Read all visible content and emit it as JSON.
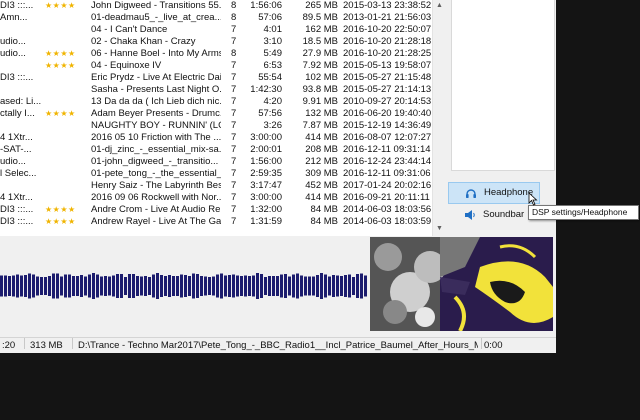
{
  "playlist": {
    "rows": [
      {
        "source": "DI3 :::...",
        "rating": "★★★★",
        "title": "John Digweed - Transitions 55...",
        "track": "8",
        "length": "1:56:06",
        "size": "265 MB",
        "date": "2015-03-13 23:38:52"
      },
      {
        "source": "Amn...",
        "rating": "",
        "title": "01-deadmau5_-_live_at_crea...",
        "track": "8",
        "length": "57:06",
        "size": "89.5 MB",
        "date": "2013-01-21 21:56:03"
      },
      {
        "source": "",
        "rating": "",
        "title": "04 - I Can't Dance",
        "track": "7",
        "length": "4:01",
        "size": "162 MB",
        "date": "2016-10-20 22:50:07"
      },
      {
        "source": "udio...",
        "rating": "",
        "title": "02 - Chaka Khan - Crazy",
        "track": "7",
        "length": "3:10",
        "size": "18.5 MB",
        "date": "2016-10-20 21:28:18"
      },
      {
        "source": "udio...",
        "rating": "★★★★",
        "title": "06 - Hanne Boel - Into My Arms",
        "track": "8",
        "length": "5:49",
        "size": "27.9 MB",
        "date": "2016-10-20 21:28:25"
      },
      {
        "source": "",
        "rating": "★★★★",
        "title": "04 - Equinoxe IV",
        "track": "7",
        "length": "6:53",
        "size": "7.92 MB",
        "date": "2015-05-13 19:58:07"
      },
      {
        "source": "DI3 :::...",
        "rating": "",
        "title": "Eric Prydz - Live At Electric Dai...",
        "track": "7",
        "length": "55:54",
        "size": "102 MB",
        "date": "2015-05-27 21:15:48"
      },
      {
        "source": "",
        "rating": "",
        "title": "Sasha - Presents Last Night O...",
        "track": "7",
        "length": "1:42:30",
        "size": "93.8 MB",
        "date": "2015-05-27 21:14:13"
      },
      {
        "source": "ased: Li...",
        "rating": "",
        "title": "13 Da da da ( Ich Lieb dich nic...",
        "track": "7",
        "length": "4:20",
        "size": "9.91 MB",
        "date": "2010-09-27 20:14:53"
      },
      {
        "source": "ctally I...",
        "rating": "★★★★",
        "title": "Adam Beyer Presents - Drumc...",
        "track": "7",
        "length": "57:56",
        "size": "132 MB",
        "date": "2016-06-20 19:40:40"
      },
      {
        "source": "",
        "rating": "",
        "title": "NAUGHTY BOY - RUNNIN' (LOSE...",
        "track": "7",
        "length": "3:26",
        "size": "7.87 MB",
        "date": "2015-12-19 14:36:49"
      },
      {
        "source": "4 1Xtr...",
        "rating": "",
        "title": "2016 05 10 Friction with The ...",
        "track": "7",
        "length": "3:00:00",
        "size": "414 MB",
        "date": "2016-08-07 12:07:27"
      },
      {
        "source": "-SAT-...",
        "rating": "",
        "title": "01-dj_zinc_-_essential_mix-sa...",
        "track": "7",
        "length": "2:00:01",
        "size": "208 MB",
        "date": "2016-12-11 09:31:14"
      },
      {
        "source": "udio...",
        "rating": "",
        "title": "01-john_digweed_-_transitio...",
        "track": "7",
        "length": "1:56:00",
        "size": "212 MB",
        "date": "2016-12-24 23:44:14"
      },
      {
        "source": "l Selec...",
        "rating": "",
        "title": "01-pete_tong_-_the_essential_...",
        "track": "7",
        "length": "2:59:35",
        "size": "309 MB",
        "date": "2016-12-11 09:31:06"
      },
      {
        "source": "",
        "rating": "",
        "title": "Henry Saiz - The Labyrinth Bes...",
        "track": "7",
        "length": "3:17:47",
        "size": "452 MB",
        "date": "2017-01-24 20:02:16"
      },
      {
        "source": "4 1Xtr...",
        "rating": "",
        "title": "2016 09 06 Rockwell with Nor...",
        "track": "7",
        "length": "3:00:00",
        "size": "414 MB",
        "date": "2016-09-21 20:11:11"
      },
      {
        "source": "DI3 :::...",
        "rating": "★★★★",
        "title": "Andre Crom - Live At Audio Re...",
        "track": "7",
        "length": "1:32:00",
        "size": "84 MB",
        "date": "2014-06-03 18:03:56"
      },
      {
        "source": "DI3 :::...",
        "rating": "★★★★",
        "title": "Andrew Rayel - Live At The Gal...",
        "track": "7",
        "length": "1:31:59",
        "size": "84 MB",
        "date": "2014-06-03 18:03:59"
      }
    ]
  },
  "devices": [
    {
      "label": "Headphone",
      "icon": "headphones-icon",
      "highlighted": true
    },
    {
      "label": "Soundbar",
      "icon": "speaker-icon",
      "highlighted": false
    }
  ],
  "tooltip": "DSP settings/Headphone",
  "status": {
    "time": ":20",
    "total_size": "313 MB",
    "path": "D:\\Trance - Techno Mar2017\\Pete_Tong_-_BBC_Radio1__Incl_Patrice_Baumel_After_Hours_M",
    "extra": "0:00"
  },
  "colors": {
    "visualizer_bar": "#1c1c6e",
    "rating_star": "#f0b400",
    "selection": "#cce4f7"
  }
}
